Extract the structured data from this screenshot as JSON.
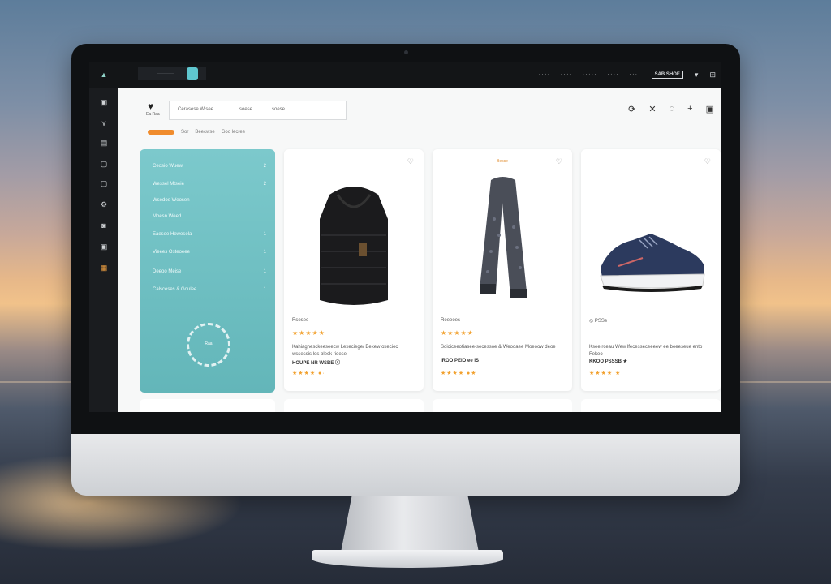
{
  "topbar": {
    "search_text": "··········",
    "nav": [
      "· · · ·",
      "· · · ·",
      "· · · · ·",
      "· · · ·",
      "· · · ·"
    ],
    "badge": "SAB SHOE",
    "caret": "▾"
  },
  "content": {
    "search_terms": [
      "Cerasese Wisee",
      "soese",
      "soese"
    ],
    "filter_labels": [
      "Sor",
      "Beecwse",
      "Goo lecree"
    ],
    "logo_sub": "Ea Raa"
  },
  "categories": [
    {
      "label": "Ceosio Wuew",
      "count": "2"
    },
    {
      "label": "Wessel Mtseie",
      "count": "2"
    },
    {
      "label": "Wsedoe Weosen",
      "count": ""
    },
    {
      "label": "Moesn Weed",
      "count": ""
    },
    {
      "label": "Eaesee Hewesela",
      "count": "1"
    },
    {
      "label": "Vieees Osteoeee",
      "count": "1"
    },
    {
      "label": "Deeoo Meise",
      "count": "1"
    },
    {
      "label": "Calsceses & Goulee",
      "count": "1"
    }
  ],
  "ring_label": "Raa",
  "products": [
    {
      "tag": "",
      "name": "Rsesee",
      "stars": "★★★★★",
      "desc": "Kahiagnesckeeseecw Lexeciege/ Bekew oxeciec wssessis los bleck rioese",
      "price": "HOUPE NR WSBE ⓧ",
      "rating2": "★★★★ ●·"
    },
    {
      "tag": "Besce",
      "name": "Reeeoes",
      "stars": "★★★★★",
      "desc": "Soiciceeotiasee-secessoe & Weooaee Moeoow deoe",
      "price": "IROO PEIO ee IS",
      "rating2": "★★★★ ●★"
    },
    {
      "tag": "",
      "name": "◎ PSSe",
      "stars": "",
      "desc": "Ksee rceau Wew lfecesseceeeew ee beeeseue ento Fekeo",
      "price": "KKOO PSSSB ★",
      "rating2": "★★★★ ★"
    }
  ],
  "colors": {
    "accent": "#5fc7cf",
    "panel": "#6dbfc2",
    "star": "#f2a12e",
    "filter_pill": "#f08c2d"
  }
}
